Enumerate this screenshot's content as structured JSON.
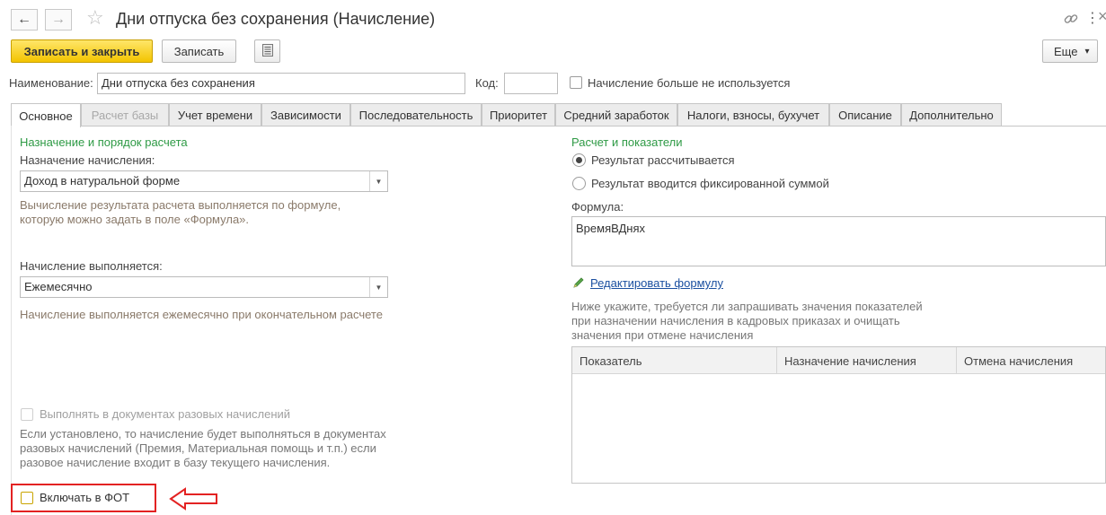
{
  "window": {
    "title": "Дни отпуска без сохранения (Начисление)",
    "back_icon": "←",
    "forward_icon": "→",
    "star_icon": "☆",
    "link_icon": "link-icon",
    "menu_icon": "⋮",
    "close_icon": "×"
  },
  "toolbar": {
    "save_close_label": "Записать и закрыть",
    "save_label": "Записать",
    "more_label": "Еще",
    "more_caret": "▾"
  },
  "header": {
    "name_label": "Наименование:",
    "name_value": "Дни отпуска без сохранения",
    "code_label": "Код:",
    "code_value": "",
    "unused_label": "Начисление больше не используется"
  },
  "tabs": [
    {
      "label": "Основное"
    },
    {
      "label": "Расчет базы"
    },
    {
      "label": "Учет времени"
    },
    {
      "label": "Зависимости"
    },
    {
      "label": "Последовательность"
    },
    {
      "label": "Приоритет"
    },
    {
      "label": "Средний заработок"
    },
    {
      "label": "Налоги, взносы, бухучет"
    },
    {
      "label": "Описание"
    },
    {
      "label": "Дополнительно"
    }
  ],
  "left": {
    "section_title": "Назначение и порядок расчета",
    "purpose_label": "Назначение начисления:",
    "purpose_value": "Доход в натуральной форме",
    "purpose_hint": "Вычисление результата расчета выполняется по формуле, которую можно задать в поле «Формула».",
    "period_label": "Начисление выполняется:",
    "period_value": "Ежемесячно",
    "period_hint": "Начисление выполняется ежемесячно при окончательном расчете",
    "onetime_label": "Выполнять в документах разовых начислений",
    "onetime_hint": "Если установлено, то начисление будет выполняться в документах разовых начислений (Премия, Материальная помощь и т.п.) если разовое начисление входит в базу текущего начисления.",
    "fot_label": "Включать в ФОТ"
  },
  "right": {
    "section_title": "Расчет и показатели",
    "radio_calculated": "Результат рассчитывается",
    "radio_fixed": "Результат вводится фиксированной суммой",
    "formula_label": "Формула:",
    "formula_value": "ВремяВДнях",
    "edit_formula_link": "Редактировать формулу",
    "indicators_hint": "Ниже укажите, требуется ли запрашивать значения показателей при назначении начисления в кадровых приказах и очищать значения при отмене начисления",
    "table_headers": [
      "Показатель",
      "Назначение начисления",
      "Отмена начисления"
    ]
  },
  "colors": {
    "accent_yellow": "#f3c400",
    "section_green": "#2e9a45",
    "highlight_red": "#e32222",
    "link_blue": "#1a4fa0"
  }
}
